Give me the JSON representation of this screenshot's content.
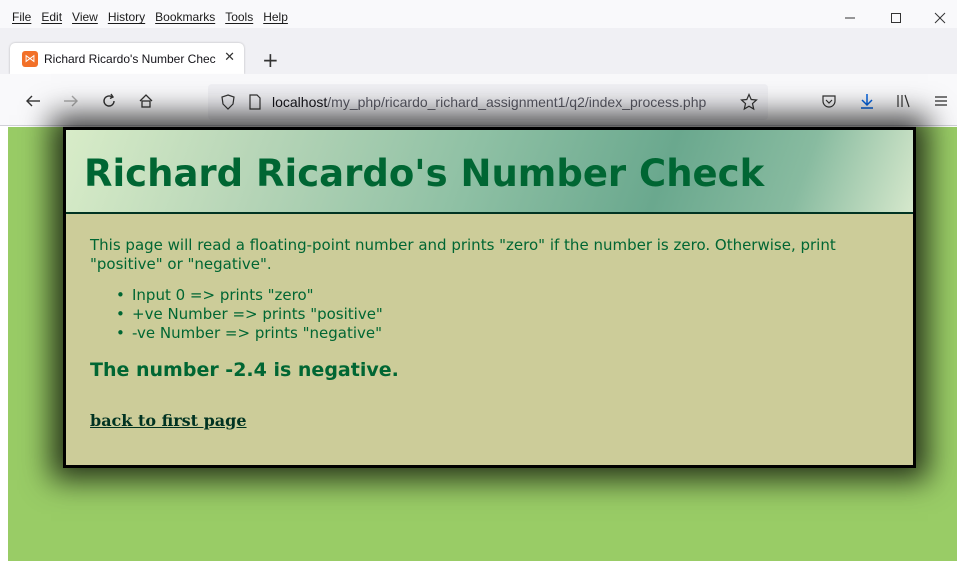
{
  "menu": [
    "File",
    "Edit",
    "View",
    "History",
    "Bookmarks",
    "Tools",
    "Help"
  ],
  "window_controls": {
    "minimize_icon": "minimize-icon",
    "maximize_icon": "maximize-icon",
    "close_icon": "close-icon"
  },
  "tab": {
    "title": "Richard Ricardo's Number Chec",
    "favicon": "xampp-icon"
  },
  "nav": {
    "url_host": "localhost",
    "url_path": "/my_php/ricardo_richard_assignment1/q2/index_process.php"
  },
  "page": {
    "title": "Richard Ricardo's Number Check",
    "intro": "This page will read a floating-point number and prints \"zero\" if the number is zero. Otherwise, print \"positive\" or \"negative\".",
    "rules": [
      "Input 0 => prints \"zero\"",
      "+ve Number => prints \"positive\"",
      "-ve Number => prints \"negative\""
    ],
    "result": "The number -2.4 is negative.",
    "back_link": "back to first page"
  },
  "colors": {
    "page_bg": "#99cc66",
    "card_bg": "#cccc99",
    "text": "#006633",
    "link": "#003322"
  }
}
